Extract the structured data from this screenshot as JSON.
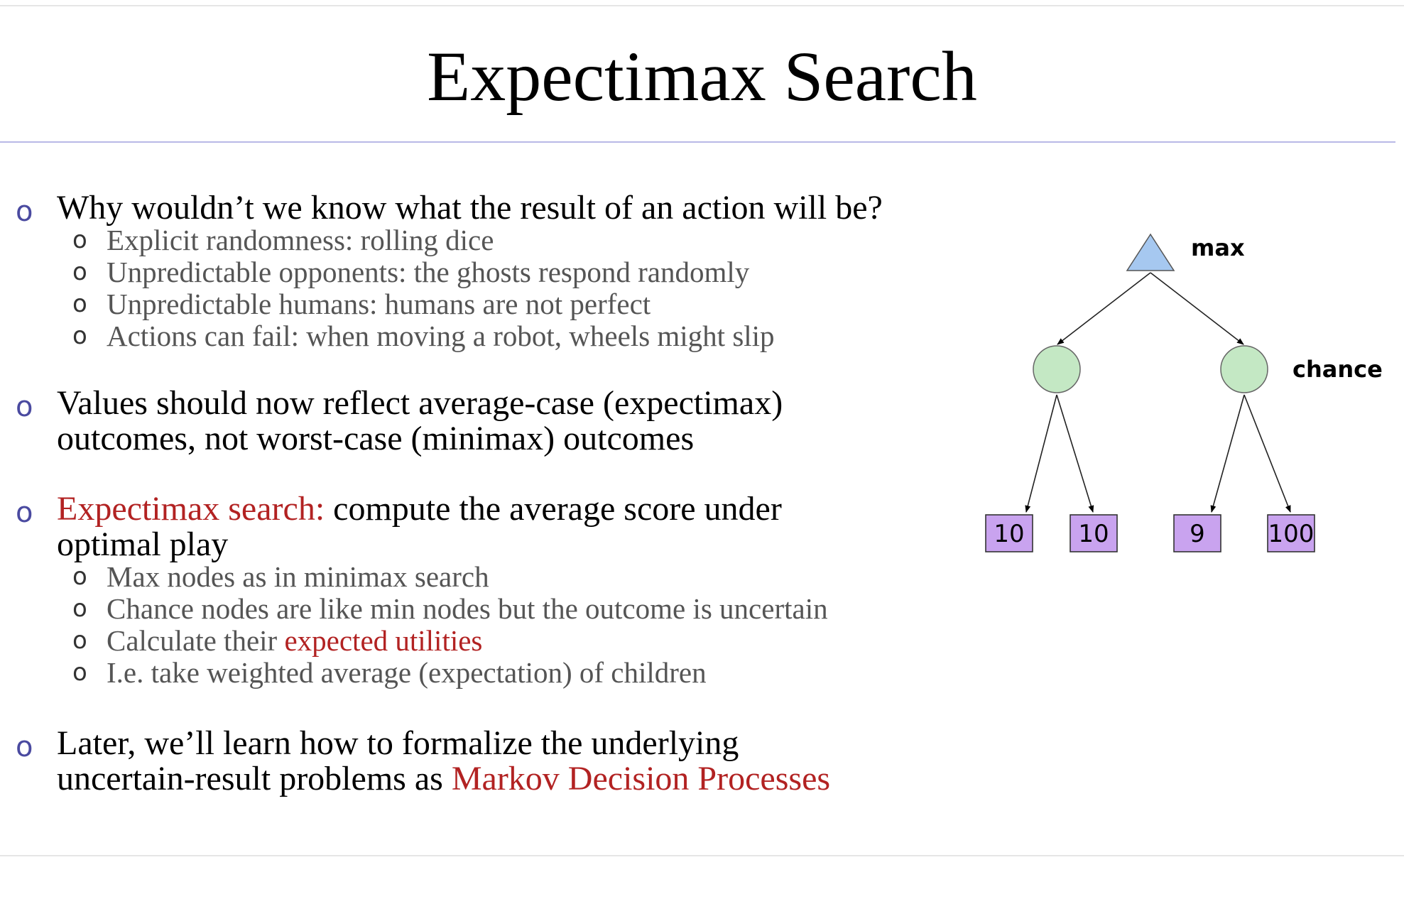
{
  "slide": {
    "title": "Expectimax Search",
    "bullets": [
      {
        "lines": [
          "Why wouldn’t we know what the result of an action will be?"
        ],
        "sub": [
          "Explicit randomness: rolling dice",
          "Unpredictable opponents: the ghosts respond randomly",
          "Unpredictable humans: humans are not perfect",
          "Actions can fail: when moving a robot, wheels might slip"
        ]
      },
      {
        "lines": [
          "Values should now reflect average-case (expectimax)",
          "outcomes, not worst-case (minimax) outcomes"
        ]
      },
      {
        "red_lead": "Expectimax search:",
        "lead_rest": " compute the average score under",
        "line2": "optimal play",
        "sub": [
          "Max nodes as in minimax search",
          "Chance nodes are like min nodes but the outcome is uncertain",
          {
            "text": "Calculate their ",
            "red": "expected utilities"
          },
          "I.e. take weighted average (expectation) of children"
        ]
      },
      {
        "line1": "Later, we’ll learn how to formalize the underlying",
        "line2_text": "uncertain-result problems as ",
        "line2_red": "Markov Decision Processes"
      }
    ],
    "bullet_glyph": "o"
  },
  "tree": {
    "max_label": "max",
    "chance_label": "chance",
    "leaves": [
      "10",
      "10",
      "9",
      "100"
    ],
    "colors": {
      "max_fill": "#a6c8f0",
      "chance_fill": "#c4e8c4",
      "leaf_fill": "#c9a3ef",
      "accent_red": "#b22222"
    }
  }
}
